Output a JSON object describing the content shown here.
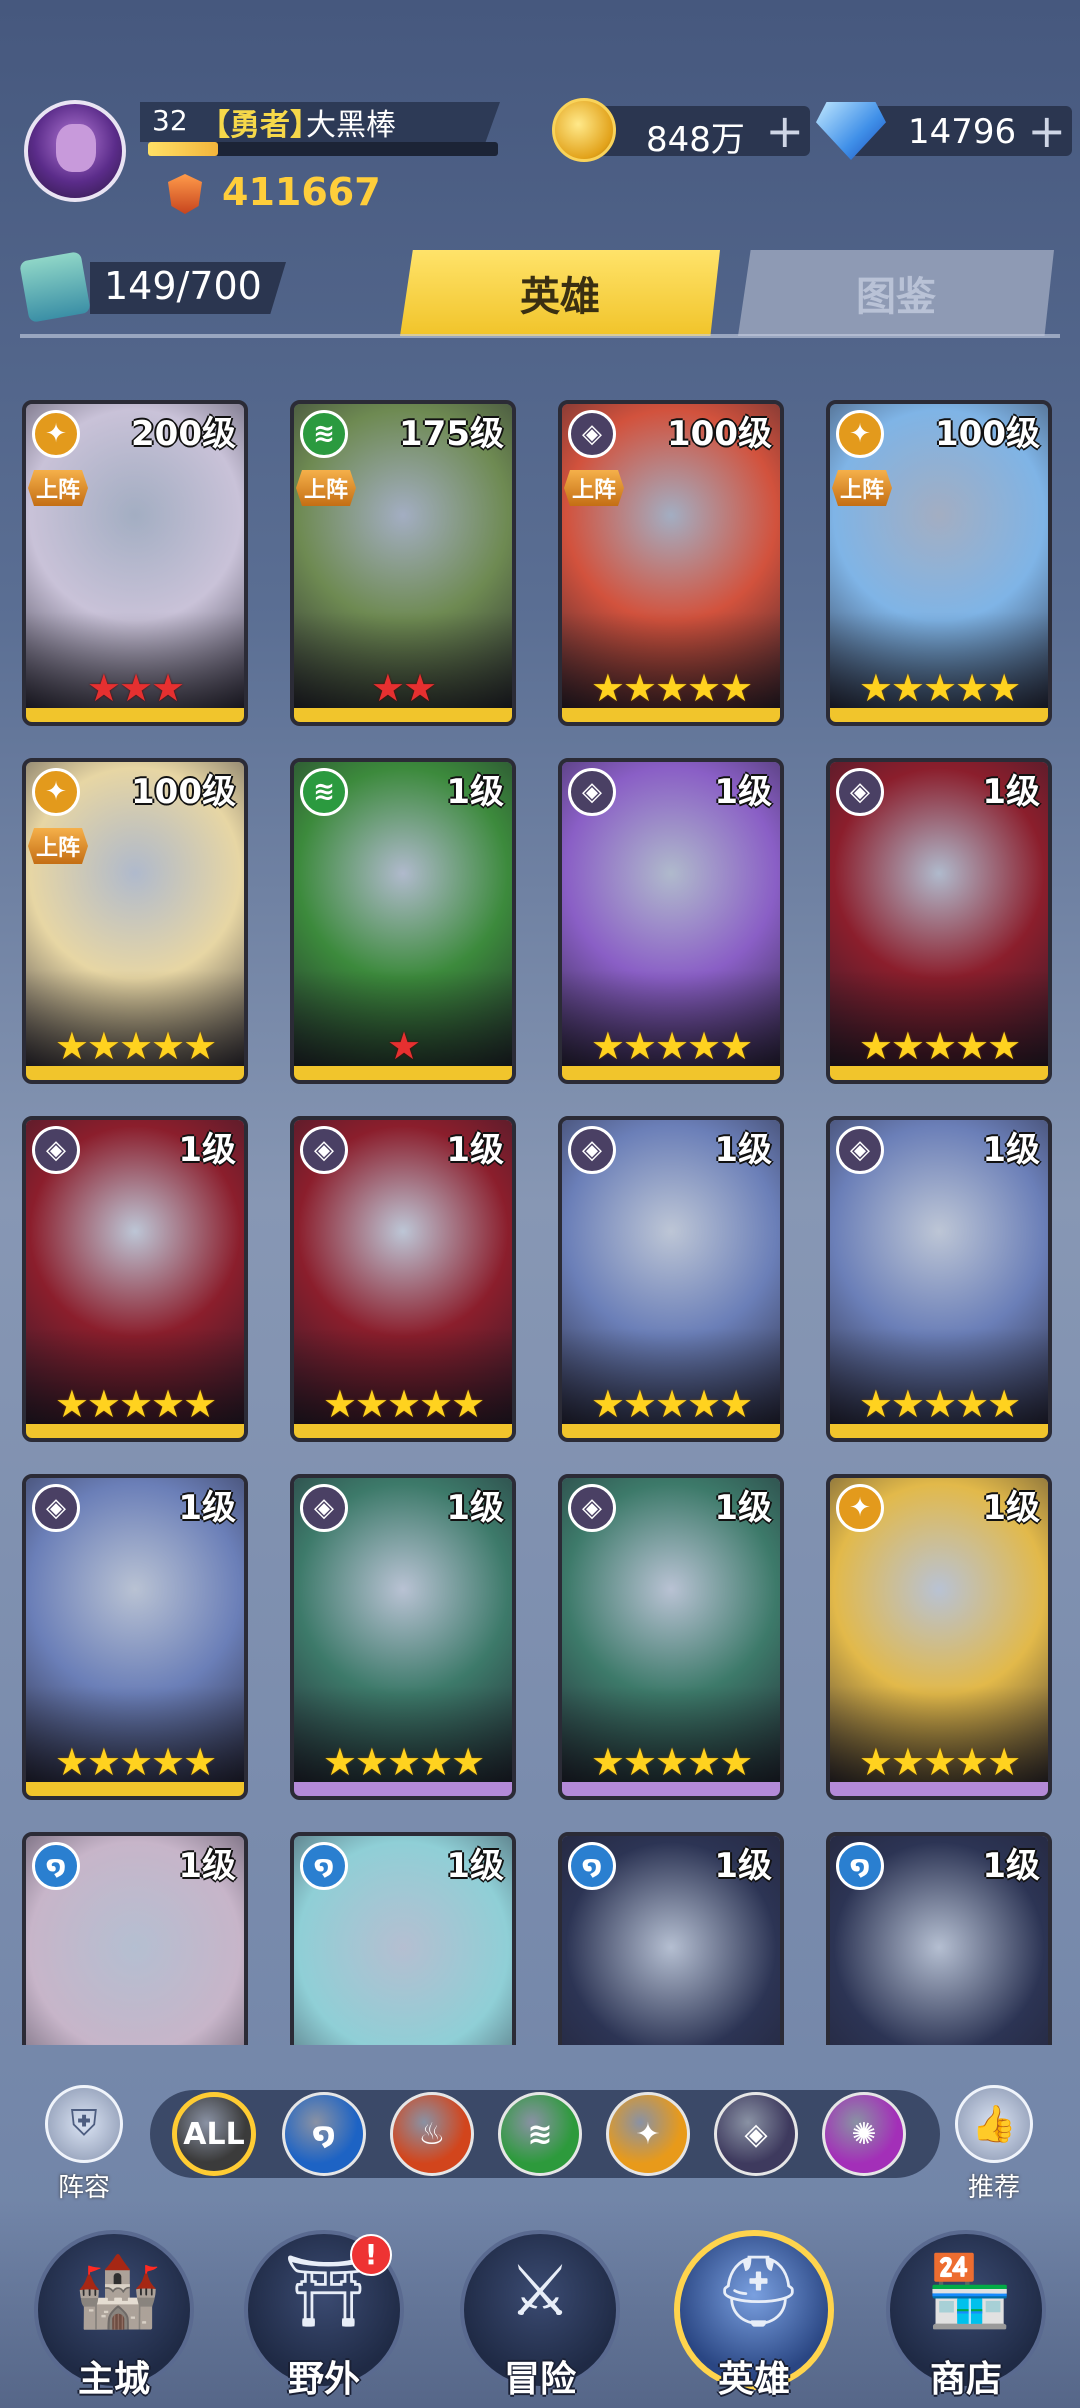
{
  "player": {
    "level": "32",
    "title": "【勇者】",
    "name": "大黑棒",
    "exp_fraction": 0.2,
    "power": "411667"
  },
  "resources": {
    "gold": "848万",
    "gems": "14796",
    "plus": "+"
  },
  "hero_count": "149/700",
  "tabs": {
    "heroes": "英雄",
    "codex": "图鉴"
  },
  "deploy_label": "上阵",
  "heroes": [
    {
      "level": "200级",
      "element": "light",
      "deployed": true,
      "stars": 3,
      "star_color": "red",
      "bg": "#c9c2d8",
      "bottom": "#f1c52c"
    },
    {
      "level": "175级",
      "element": "wind",
      "deployed": true,
      "stars": 2,
      "star_color": "red",
      "bg": "#6e8a52",
      "bottom": "#f1c52c"
    },
    {
      "level": "100级",
      "element": "shadow",
      "deployed": true,
      "stars": 5,
      "star_color": "gold",
      "bg": "#d2523d",
      "bottom": "#f1c52c"
    },
    {
      "level": "100级",
      "element": "light",
      "deployed": true,
      "stars": 5,
      "star_color": "gold",
      "bg": "#7fb4e6",
      "bottom": "#f1c52c"
    },
    {
      "level": "100级",
      "element": "light",
      "deployed": true,
      "stars": 5,
      "star_color": "gold",
      "bg": "#e7d6a4",
      "bottom": "#f1c52c"
    },
    {
      "level": "1级",
      "element": "wind",
      "deployed": false,
      "stars": 1,
      "star_color": "red",
      "bg": "#3c8a3c",
      "bottom": "#f1c52c"
    },
    {
      "level": "1级",
      "element": "shadow",
      "deployed": false,
      "stars": 5,
      "star_color": "gold",
      "bg": "#8a5fc6",
      "bottom": "#f1c52c"
    },
    {
      "level": "1级",
      "element": "shadow",
      "deployed": false,
      "stars": 5,
      "star_color": "gold",
      "bg": "#8b1e2c",
      "bottom": "#f1c52c"
    },
    {
      "level": "1级",
      "element": "shadow",
      "deployed": false,
      "stars": 5,
      "star_color": "gold",
      "bg": "#8b1e2c",
      "bottom": "#f1c52c"
    },
    {
      "level": "1级",
      "element": "shadow",
      "deployed": false,
      "stars": 5,
      "star_color": "gold",
      "bg": "#8b1e2c",
      "bottom": "#f1c52c"
    },
    {
      "level": "1级",
      "element": "shadow",
      "deployed": false,
      "stars": 5,
      "star_color": "gold",
      "bg": "#6b7fb8",
      "bottom": "#f1c52c"
    },
    {
      "level": "1级",
      "element": "shadow",
      "deployed": false,
      "stars": 5,
      "star_color": "gold",
      "bg": "#6b7fb8",
      "bottom": "#f1c52c"
    },
    {
      "level": "1级",
      "element": "shadow",
      "deployed": false,
      "stars": 5,
      "star_color": "gold",
      "bg": "#6b7fb8",
      "bottom": "#f1c52c"
    },
    {
      "level": "1级",
      "element": "shadow",
      "deployed": false,
      "stars": 5,
      "star_color": "gold",
      "bg": "#3d7a6a",
      "bottom": "#b48ad8"
    },
    {
      "level": "1级",
      "element": "shadow",
      "deployed": false,
      "stars": 5,
      "star_color": "gold",
      "bg": "#3d7a6a",
      "bottom": "#b48ad8"
    },
    {
      "level": "1级",
      "element": "light",
      "deployed": false,
      "stars": 5,
      "star_color": "gold",
      "bg": "#e2b94a",
      "bottom": "#b48ad8"
    },
    {
      "level": "1级",
      "element": "water",
      "deployed": false,
      "stars": 0,
      "star_color": "gold",
      "bg": "#c7b5c9",
      "bottom": "#b48ad8"
    },
    {
      "level": "1级",
      "element": "water",
      "deployed": false,
      "stars": 0,
      "star_color": "gold",
      "bg": "#8fcfd6",
      "bottom": "#b48ad8"
    },
    {
      "level": "1级",
      "element": "water",
      "deployed": false,
      "stars": 0,
      "star_color": "gold",
      "bg": "#2c3454",
      "bottom": "#b48ad8"
    },
    {
      "level": "1级",
      "element": "water",
      "deployed": false,
      "stars": 0,
      "star_color": "gold",
      "bg": "#2c3454",
      "bottom": "#b48ad8"
    }
  ],
  "element_colors": {
    "light": "#e39a1c",
    "wind": "#2b9a3f",
    "shadow": "#4a4064",
    "water": "#2a7fd0"
  },
  "filters": {
    "all_label": "ALL",
    "items": [
      {
        "name": "all",
        "color": "#3b3b3b"
      },
      {
        "name": "water",
        "color": "#1d63c4"
      },
      {
        "name": "fire",
        "color": "#d2451c"
      },
      {
        "name": "wind",
        "color": "#2d9a3c"
      },
      {
        "name": "light",
        "color": "#e89a1a"
      },
      {
        "name": "shadow",
        "color": "#3e3a5e"
      },
      {
        "name": "arcane",
        "color": "#a32fb8"
      }
    ]
  },
  "side_buttons": {
    "lineup": "阵容",
    "recommend": "推荐"
  },
  "nav": {
    "main_city": "主城",
    "wild": "野外",
    "adventure": "冒险",
    "heroes": "英雄",
    "shop": "商店",
    "wild_alert": "!"
  }
}
